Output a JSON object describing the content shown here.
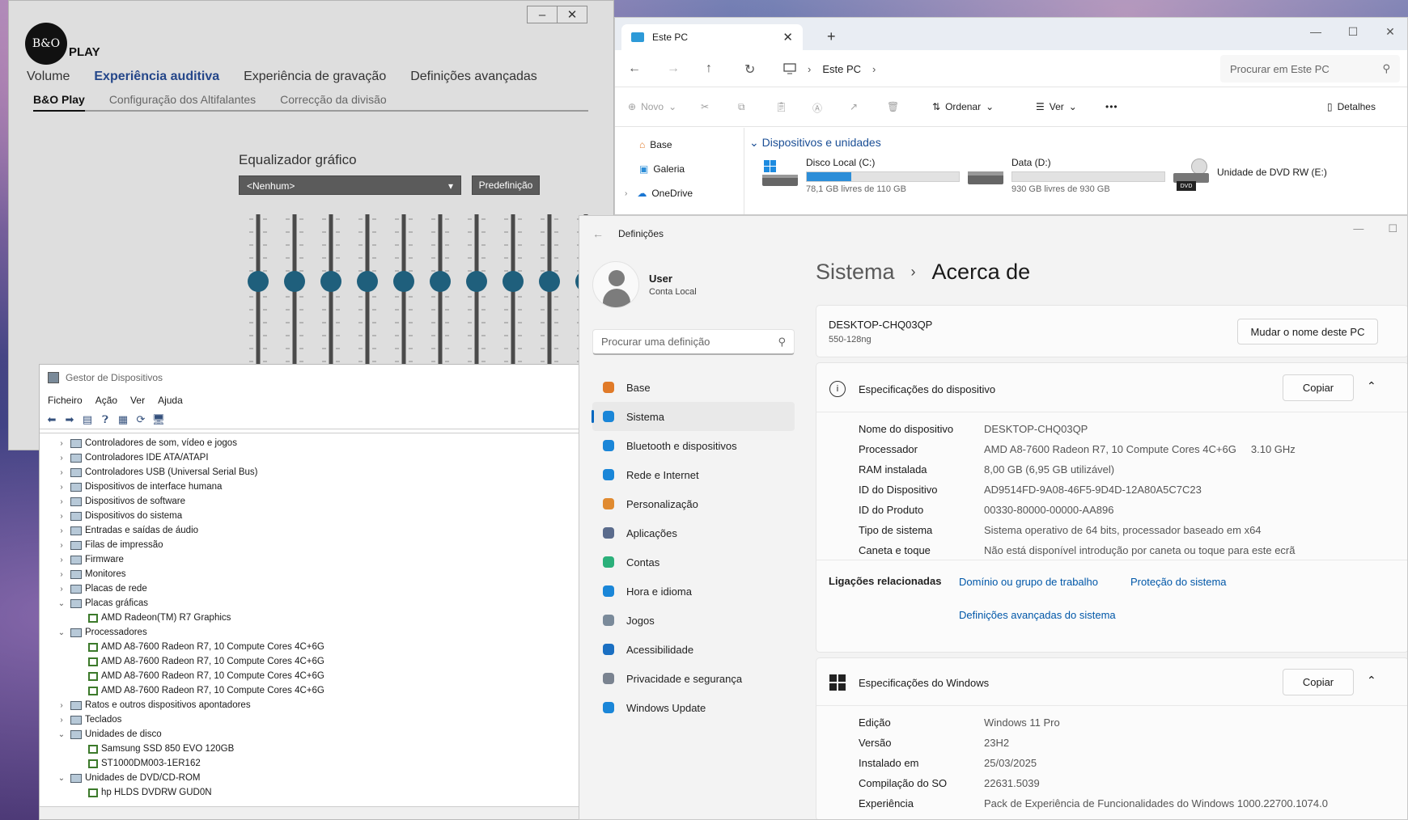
{
  "bo": {
    "logo_text": "B&O",
    "logo_play": "PLAY",
    "window_buttons": [
      "–",
      "✕"
    ],
    "main_tabs": [
      "Volume",
      "Experiência auditiva",
      "Experiência de gravação",
      "Definições avançadas"
    ],
    "active_main_tab": "Experiência auditiva",
    "sub_tabs": [
      "B&O Play",
      "Configuração dos Altifalantes",
      "Correcção da divisão"
    ],
    "equalizer_title": "Equalizador gráfico",
    "preset_value": "<Nenhum>",
    "preset_button": "Predefinição",
    "slider_levels": [
      0,
      0,
      0,
      0,
      0,
      0,
      0,
      0,
      0,
      0
    ],
    "accent": "#1f5f7c"
  },
  "explorer": {
    "tab_title": "Este PC",
    "tab_close": "✕",
    "tab_new": "+",
    "breadcrumb": [
      "Este PC"
    ],
    "search_placeholder": "Procurar em Este PC",
    "toolbar": {
      "new": "Novo",
      "sort": "Ordenar",
      "view": "Ver",
      "more": "•••",
      "details": "Detalhes"
    },
    "nav": [
      "Base",
      "Galeria",
      "OneDrive"
    ],
    "section_title": "Dispositivos e unidades",
    "drives": [
      {
        "name": "Disco Local (C:)",
        "free": "78,1 GB livres de 110 GB",
        "used_fraction": 0.29
      },
      {
        "name": "Data (D:)",
        "free": "930 GB livres de 930 GB",
        "used_fraction": 0.0
      }
    ],
    "dvd": {
      "name": "Unidade de DVD RW (E:)",
      "label": "DVD"
    }
  },
  "device_manager": {
    "title": "Gestor de Dispositivos",
    "menu": [
      "Ficheiro",
      "Ação",
      "Ver",
      "Ajuda"
    ],
    "tree": [
      {
        "label": "Controladores de som, vídeo e jogos",
        "level": 0,
        "exp": "›"
      },
      {
        "label": "Controladores IDE ATA/ATAPI",
        "level": 0,
        "exp": "›"
      },
      {
        "label": "Controladores USB (Universal Serial Bus)",
        "level": 0,
        "exp": "›"
      },
      {
        "label": "Dispositivos de interface humana",
        "level": 0,
        "exp": "›"
      },
      {
        "label": "Dispositivos de software",
        "level": 0,
        "exp": "›"
      },
      {
        "label": "Dispositivos do sistema",
        "level": 0,
        "exp": "›"
      },
      {
        "label": "Entradas e saídas de áudio",
        "level": 0,
        "exp": "›"
      },
      {
        "label": "Filas de impressão",
        "level": 0,
        "exp": "›"
      },
      {
        "label": "Firmware",
        "level": 0,
        "exp": "›"
      },
      {
        "label": "Monitores",
        "level": 0,
        "exp": "›"
      },
      {
        "label": "Placas de rede",
        "level": 0,
        "exp": "›"
      },
      {
        "label": "Placas gráficas",
        "level": 0,
        "exp": "⌄"
      },
      {
        "label": "AMD Radeon(TM) R7 Graphics",
        "level": 1,
        "exp": ""
      },
      {
        "label": "Processadores",
        "level": 0,
        "exp": "⌄"
      },
      {
        "label": "AMD A8-7600 Radeon R7, 10 Compute Cores 4C+6G",
        "level": 1,
        "exp": ""
      },
      {
        "label": "AMD A8-7600 Radeon R7, 10 Compute Cores 4C+6G",
        "level": 1,
        "exp": ""
      },
      {
        "label": "AMD A8-7600 Radeon R7, 10 Compute Cores 4C+6G",
        "level": 1,
        "exp": ""
      },
      {
        "label": "AMD A8-7600 Radeon R7, 10 Compute Cores 4C+6G",
        "level": 1,
        "exp": ""
      },
      {
        "label": "Ratos e outros dispositivos apontadores",
        "level": 0,
        "exp": "›"
      },
      {
        "label": "Teclados",
        "level": 0,
        "exp": "›"
      },
      {
        "label": "Unidades de disco",
        "level": 0,
        "exp": "⌄"
      },
      {
        "label": "Samsung SSD 850 EVO 120GB",
        "level": 1,
        "exp": ""
      },
      {
        "label": "ST1000DM003-1ER162",
        "level": 1,
        "exp": ""
      },
      {
        "label": "Unidades de DVD/CD-ROM",
        "level": 0,
        "exp": "⌄"
      },
      {
        "label": "hp HLDS DVDRW  GUD0N",
        "level": 1,
        "exp": ""
      }
    ]
  },
  "settings": {
    "app_title": "Definições",
    "back_icon": "←",
    "window_controls": [
      "—",
      "☐"
    ],
    "user_name": "User",
    "user_type": "Conta Local",
    "search_placeholder": "Procurar uma definição",
    "nav": [
      {
        "label": "Base",
        "icon": "home-icon",
        "color": "#e07a28"
      },
      {
        "label": "Sistema",
        "icon": "system-icon",
        "color": "#1a86d8"
      },
      {
        "label": "Bluetooth e dispositivos",
        "icon": "bluetooth-icon",
        "color": "#1a86d8"
      },
      {
        "label": "Rede e Internet",
        "icon": "wifi-icon",
        "color": "#1a86d8"
      },
      {
        "label": "Personalização",
        "icon": "brush-icon",
        "color": "#e08a30"
      },
      {
        "label": "Aplicações",
        "icon": "apps-icon",
        "color": "#5a6b8c"
      },
      {
        "label": "Contas",
        "icon": "accounts-icon",
        "color": "#2bb07a"
      },
      {
        "label": "Hora e idioma",
        "icon": "clock-globe-icon",
        "color": "#1a86d8"
      },
      {
        "label": "Jogos",
        "icon": "gamepad-icon",
        "color": "#7a8a9a"
      },
      {
        "label": "Acessibilidade",
        "icon": "accessibility-icon",
        "color": "#1a6fc2"
      },
      {
        "label": "Privacidade e segurança",
        "icon": "shield-icon",
        "color": "#7a8390"
      },
      {
        "label": "Windows Update",
        "icon": "update-icon",
        "color": "#1a86d8"
      }
    ],
    "active_nav": "Sistema",
    "heading_parent": "Sistema",
    "heading_sep": "›",
    "heading_page": "Acerca de",
    "pc_name": "DESKTOP-CHQ03QP",
    "pc_model": "550-128ng",
    "rename_button": "Mudar o nome deste PC",
    "device_specs": {
      "title": "Especificações do dispositivo",
      "copy": "Copiar",
      "rows": [
        {
          "k": "Nome do dispositivo",
          "v": "DESKTOP-CHQ03QP"
        },
        {
          "k": "Processador",
          "v": "AMD A8-7600 Radeon R7, 10 Compute Cores 4C+6G     3.10 GHz"
        },
        {
          "k": "RAM instalada",
          "v": "8,00 GB (6,95 GB utilizável)"
        },
        {
          "k": "ID do Dispositivo",
          "v": "AD9514FD-9A08-46F5-9D4D-12A80A5C7C23"
        },
        {
          "k": "ID do Produto",
          "v": "00330-80000-00000-AA896"
        },
        {
          "k": "Tipo de sistema",
          "v": "Sistema operativo de 64 bits, processador baseado em x64"
        },
        {
          "k": "Caneta e toque",
          "v": "Não está disponível introdução por caneta ou toque para este ecrã"
        }
      ]
    },
    "related": {
      "label": "Ligações relacionadas",
      "links": [
        "Domínio ou grupo de trabalho",
        "Proteção do sistema",
        "Definições avançadas do sistema"
      ]
    },
    "windows_specs": {
      "title": "Especificações do Windows",
      "copy": "Copiar",
      "rows": [
        {
          "k": "Edição",
          "v": "Windows 11 Pro"
        },
        {
          "k": "Versão",
          "v": "23H2"
        },
        {
          "k": "Instalado em",
          "v": "25/03/2025"
        },
        {
          "k": "Compilação do SO",
          "v": "22631.5039"
        },
        {
          "k": "Experiência",
          "v": "Pack de Experiência de Funcionalidades do Windows 1000.22700.1074.0"
        }
      ]
    }
  }
}
